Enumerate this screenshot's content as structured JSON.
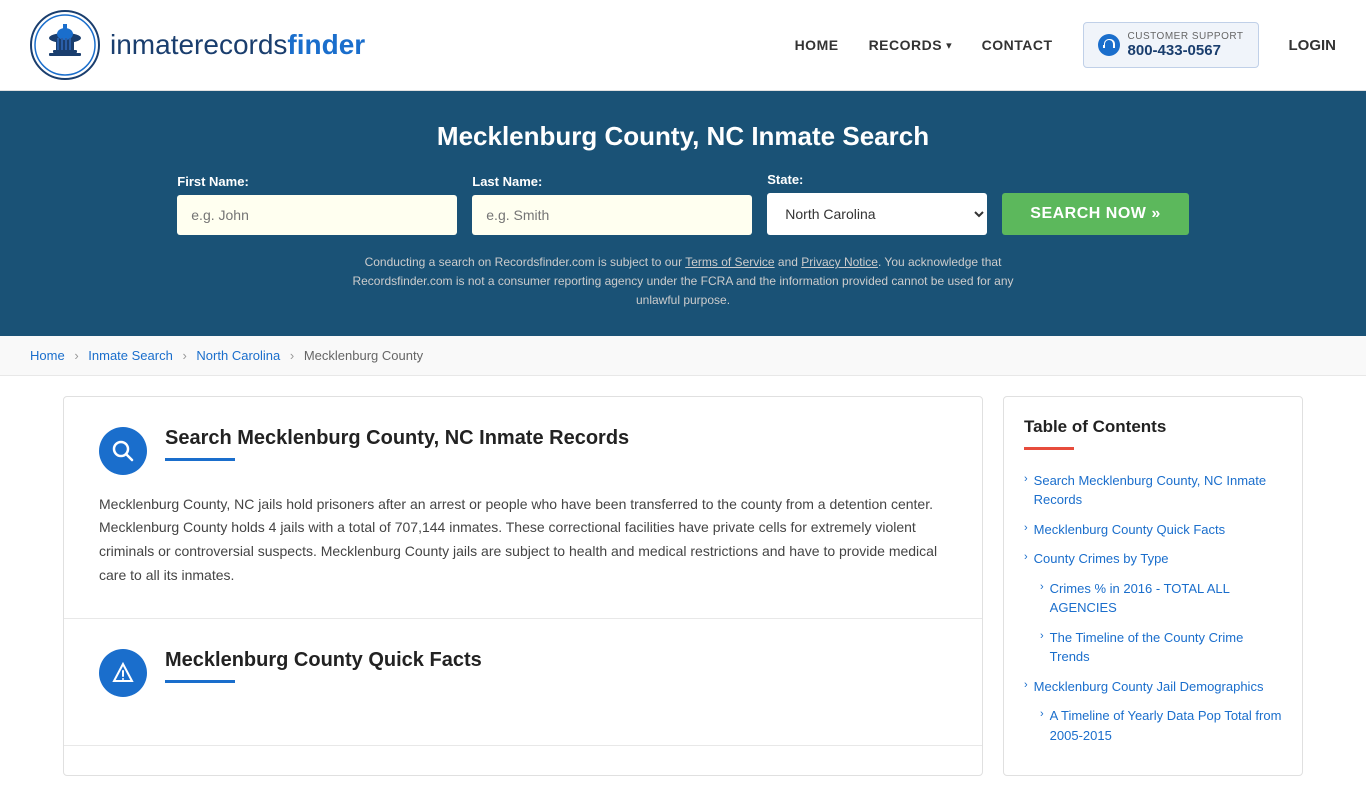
{
  "header": {
    "logo_text_main": "inmaterecords",
    "logo_text_bold": "finder",
    "nav": {
      "home": "HOME",
      "records": "RECORDS",
      "contact": "CONTACT",
      "login": "LOGIN",
      "support_label": "CUSTOMER SUPPORT",
      "support_number": "800-433-0567"
    }
  },
  "search_banner": {
    "title": "Mecklenburg County, NC Inmate Search",
    "first_name_label": "First Name:",
    "first_name_placeholder": "e.g. John",
    "last_name_label": "Last Name:",
    "last_name_placeholder": "e.g. Smith",
    "state_label": "State:",
    "state_value": "North Carolina",
    "search_btn": "SEARCH NOW »",
    "disclaimer": "Conducting a search on Recordsfinder.com is subject to our Terms of Service and Privacy Notice. You acknowledge that Recordsfinder.com is not a consumer reporting agency under the FCRA and the information provided cannot be used for any unlawful purpose."
  },
  "breadcrumb": {
    "home": "Home",
    "inmate_search": "Inmate Search",
    "north_carolina": "North Carolina",
    "mecklenburg_county": "Mecklenburg County"
  },
  "content": {
    "section1": {
      "icon": "🔍",
      "title": "Search Mecklenburg County, NC Inmate Records",
      "body": "Mecklenburg County, NC jails hold prisoners after an arrest or people who have been transferred to the county from a detention center. Mecklenburg County holds 4 jails with a total of 707,144 inmates. These correctional facilities have private cells for extremely violent criminals or controversial suspects. Mecklenburg County jails are subject to health and medical restrictions and have to provide medical care to all its inmates."
    },
    "section2": {
      "icon": "⚠",
      "title": "Mecklenburg County Quick Facts"
    }
  },
  "toc": {
    "title": "Table of Contents",
    "items": [
      {
        "label": "Search Mecklenburg County, NC Inmate Records",
        "indented": false
      },
      {
        "label": "Mecklenburg County Quick Facts",
        "indented": false
      },
      {
        "label": "County Crimes by Type",
        "indented": false
      },
      {
        "label": "Crimes % in 2016 - TOTAL ALL AGENCIES",
        "indented": true
      },
      {
        "label": "The Timeline of the County Crime Trends",
        "indented": true
      },
      {
        "label": "Mecklenburg County Jail Demographics",
        "indented": false
      },
      {
        "label": "A Timeline of Yearly Data Pop Total from 2005-2015",
        "indented": true
      }
    ]
  }
}
